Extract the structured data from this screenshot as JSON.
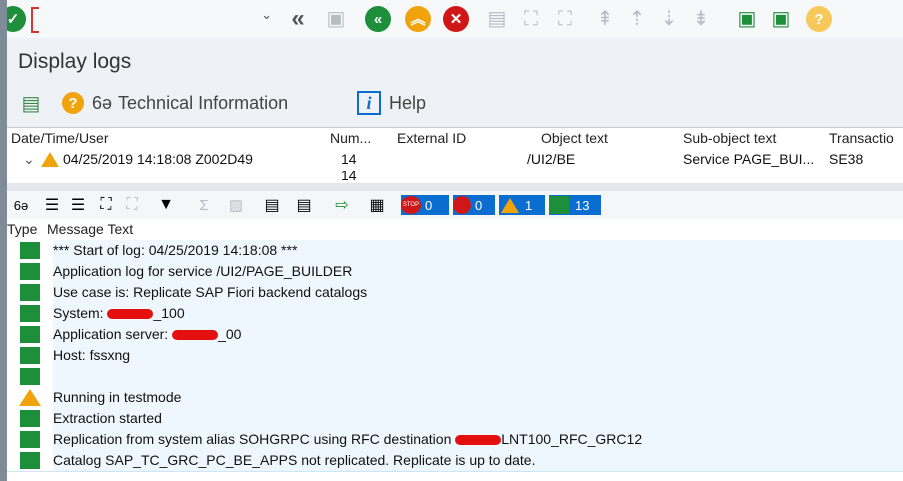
{
  "toolbar": {
    "command_field_value": "",
    "icons": [
      "enter-icon",
      "back-double-icon",
      "save-icon",
      "back-icon",
      "exit-icon",
      "cancel-icon",
      "print-icon",
      "find-icon",
      "find-next-icon",
      "first-page-icon",
      "prev-page-icon",
      "next-page-icon",
      "last-page-icon",
      "create-session-icon",
      "shortcut-icon",
      "help-icon"
    ]
  },
  "page_title": "Display logs",
  "app_toolbar": {
    "technical_info": "Technical Information",
    "help": "Help"
  },
  "log_header": {
    "columns": [
      "Date/Time/User",
      "Num...",
      "External ID",
      "Object text",
      "Sub-object text",
      "Transactio"
    ],
    "row": {
      "datetime_user": "04/25/2019  14:18:08  Z002D49",
      "num": "14",
      "external_id": "",
      "object_text": "/UI2/BE",
      "subobject_text": "Service PAGE_BUI...",
      "transaction": "SE38"
    },
    "row2_num": "14"
  },
  "msg_toolbar": {
    "counts": {
      "stop": "0",
      "error": "0",
      "warning": "1",
      "success": "13"
    }
  },
  "messages": {
    "col_type": "Type",
    "col_text": "Message Text",
    "rows": [
      {
        "type": "success",
        "text": "*** Start of log: 04/25/2019 14:18:08 ***"
      },
      {
        "type": "success",
        "text": "Application log for service /UI2/PAGE_BUILDER"
      },
      {
        "type": "success",
        "text": "Use case is: Replicate SAP Fiori backend catalogs"
      },
      {
        "type": "success",
        "pre": "System: ",
        "post": "_100"
      },
      {
        "type": "success",
        "pre": "Application server: ",
        "post": "_00"
      },
      {
        "type": "success",
        "text": "Host: fssxng"
      },
      {
        "type": "success",
        "text": ""
      },
      {
        "type": "warning",
        "text": "Running in testmode"
      },
      {
        "type": "success",
        "text": "Extraction started"
      },
      {
        "type": "success",
        "pre": "Replication from system alias SOHGRPC using RFC destination ",
        "post": "LNT100_RFC_GRC12"
      },
      {
        "type": "success",
        "text": "Catalog SAP_TC_GRC_PC_BE_APPS not replicated. Replicate is up to date."
      }
    ]
  },
  "colors": {
    "success": "#1d8f3a",
    "warning": "#f0a30a",
    "error": "#d01717",
    "accent": "#0a6ed1"
  }
}
